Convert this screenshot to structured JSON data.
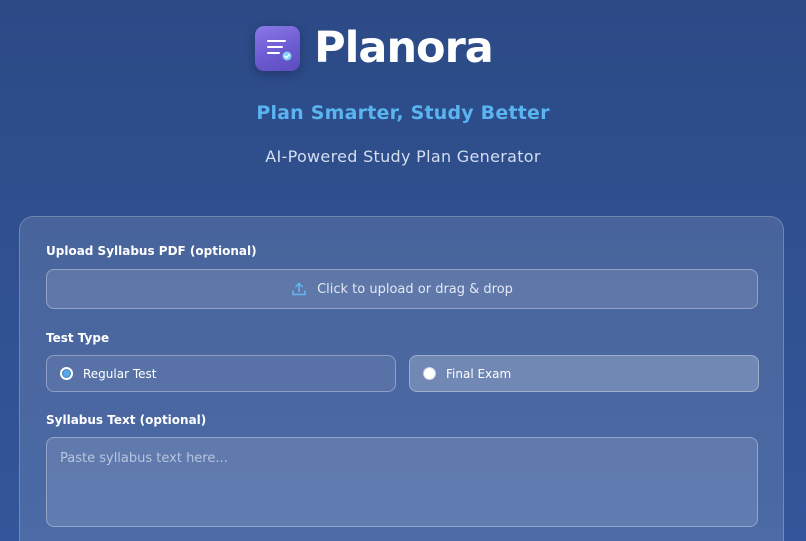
{
  "header": {
    "brand": "Planora",
    "logo_icon": "list-check-icon",
    "tagline": "Plan Smarter, Study Better",
    "subtitle": "AI-Powered Study Plan Generator"
  },
  "form": {
    "upload": {
      "label": "Upload Syllabus PDF (optional)",
      "icon": "upload-icon",
      "text": "Click to upload or drag & drop"
    },
    "test_type": {
      "label": "Test Type",
      "options": [
        {
          "label": "Regular Test",
          "selected": true
        },
        {
          "label": "Final Exam",
          "selected": false
        }
      ]
    },
    "syllabus_text": {
      "label": "Syllabus Text (optional)",
      "placeholder": "Paste syllabus text here..."
    }
  },
  "colors": {
    "accent": "#5ab4f0",
    "logo_gradient_start": "#8a79e6",
    "logo_gradient_end": "#5b4dbd",
    "background": "#2f4f8e"
  }
}
